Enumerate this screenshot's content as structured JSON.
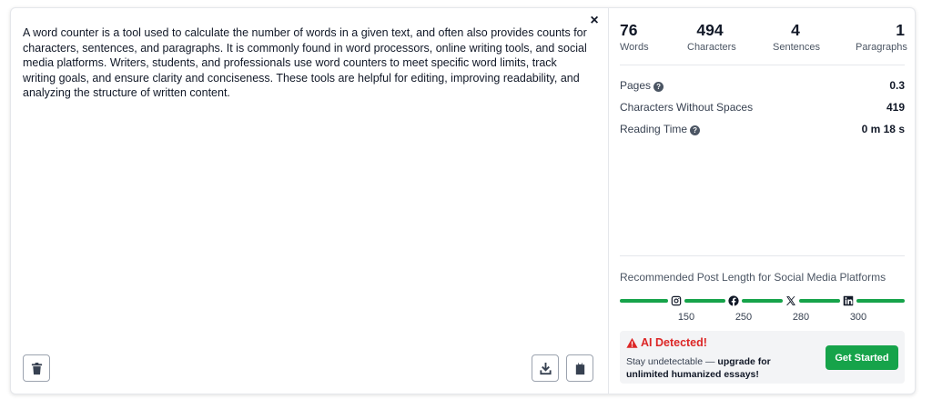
{
  "editor": {
    "text": "A word counter is a tool used to calculate the number of words in a given text, and often also provides counts for characters, sentences, and paragraphs. It is commonly found in word processors, online writing tools, and social media platforms. Writers, students, and professionals use word counters to meet specific word limits, track writing goals, and ensure clarity and conciseness. These tools are helpful for editing, improving readability, and analyzing the structure of written content.",
    "close_symbol": "×"
  },
  "stats": [
    {
      "value": "76",
      "label": "Words"
    },
    {
      "value": "494",
      "label": "Characters"
    },
    {
      "value": "4",
      "label": "Sentences"
    },
    {
      "value": "1",
      "label": "Paragraphs"
    }
  ],
  "details": {
    "pages": {
      "label": "Pages",
      "value": "0.3"
    },
    "chars_no_spaces": {
      "label": "Characters Without Spaces",
      "value": "419"
    },
    "reading_time": {
      "label": "Reading Time",
      "value": "0 m 18 s"
    },
    "help_symbol": "?"
  },
  "social": {
    "title": "Recommended Post Length for Social Media Platforms",
    "platforms": [
      {
        "icon": "instagram-icon",
        "limit": "150"
      },
      {
        "icon": "facebook-icon",
        "limit": "250"
      },
      {
        "icon": "x-icon",
        "limit": "280"
      },
      {
        "icon": "linkedin-icon",
        "limit": "300"
      }
    ],
    "bar_color": "#16a34a"
  },
  "ai": {
    "title": "AI Detected!",
    "text_plain": "Stay undetectable — ",
    "text_bold": "upgrade for unlimited humanized essays!",
    "cta_label": "Get Started",
    "alert_color": "#dc2626",
    "cta_color": "#16a34a"
  }
}
